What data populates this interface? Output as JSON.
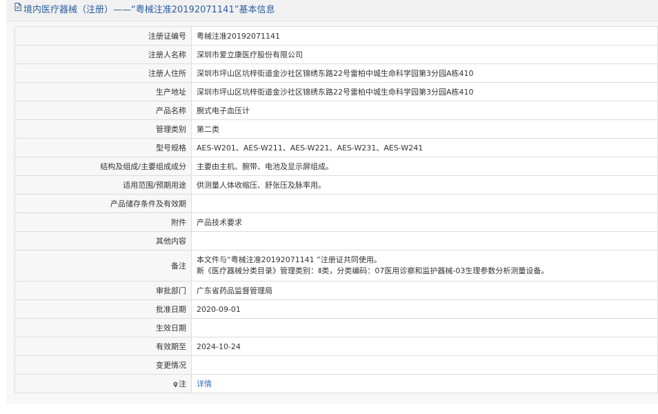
{
  "header": {
    "title": "境内医疗器械（注册）——“粤械注准20192071141”基本信息"
  },
  "rows": [
    {
      "label": "注册证编号",
      "value": "粤械注准20192071141"
    },
    {
      "label": "注册人名称",
      "value": "深圳市爱立康医疗股份有限公司"
    },
    {
      "label": "注册人住所",
      "value": "深圳市坪山区坑梓街道金沙社区锦绣东路22号雷柏中城生命科学园第3分园A栋410"
    },
    {
      "label": "生产地址",
      "value": "深圳市坪山区坑梓街道金沙社区锦绣东路22号雷柏中城生命科学园第3分园A栋410"
    },
    {
      "label": "产品名称",
      "value": "腕式电子血压计"
    },
    {
      "label": "管理类别",
      "value": "第二类"
    },
    {
      "label": "型号规格",
      "value": "AES-W201、AES-W211、AES-W221、AES-W231、AES-W241"
    },
    {
      "label": "结构及组成/主要组成成分",
      "value": "主要由主机、腕带、电池及显示屏组成。"
    },
    {
      "label": "适用范围/预期用途",
      "value": "供测量人体收缩压、舒张压及脉率用。"
    },
    {
      "label": "产品储存条件及有效期",
      "value": ""
    },
    {
      "label": "附件",
      "value": "产品技术要求"
    },
    {
      "label": "其他内容",
      "value": ""
    },
    {
      "label": "备注",
      "line1": "本文件与“粤械注准20192071141 ”注册证共同使用。",
      "line2": "新《医疗器械分类目录》管理类别：Ⅱ类，分类编码：07医用诊察和监护器械-03生理参数分析测量设备。"
    },
    {
      "label": "审批部门",
      "value": "广东省药品监督管理局"
    },
    {
      "label": "批准日期",
      "value": "2020-09-01"
    },
    {
      "label": "生效日期",
      "value": ""
    },
    {
      "label": "有效期至",
      "value": "2024-10-24"
    },
    {
      "label": "变更情况",
      "value": ""
    },
    {
      "label": "注",
      "value": "详情"
    }
  ]
}
